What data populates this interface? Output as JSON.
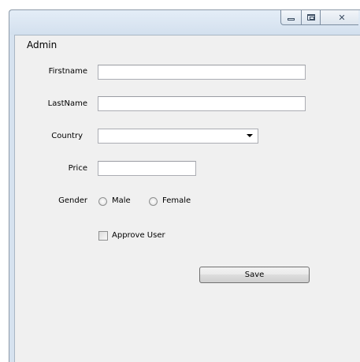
{
  "window": {
    "controls": {
      "minimize_icon": "minimize-icon",
      "maximize_icon": "maximize-icon",
      "close_icon": "close-icon",
      "close_glyph": "✕"
    }
  },
  "form": {
    "title": "Admin",
    "firstname": {
      "label": "Firstname",
      "value": ""
    },
    "lastname": {
      "label": "LastName",
      "value": ""
    },
    "country": {
      "label": "Country",
      "selected": ""
    },
    "price": {
      "label": "Price",
      "value": ""
    },
    "gender": {
      "label": "Gender",
      "options": [
        "Male",
        "Female"
      ]
    },
    "approve": {
      "label": "Approve User"
    },
    "save_label": "Save"
  },
  "colors": {
    "titlebar": "#d6e2ef",
    "client_background": "#f0f0f0",
    "input_border": "#abadb3"
  }
}
